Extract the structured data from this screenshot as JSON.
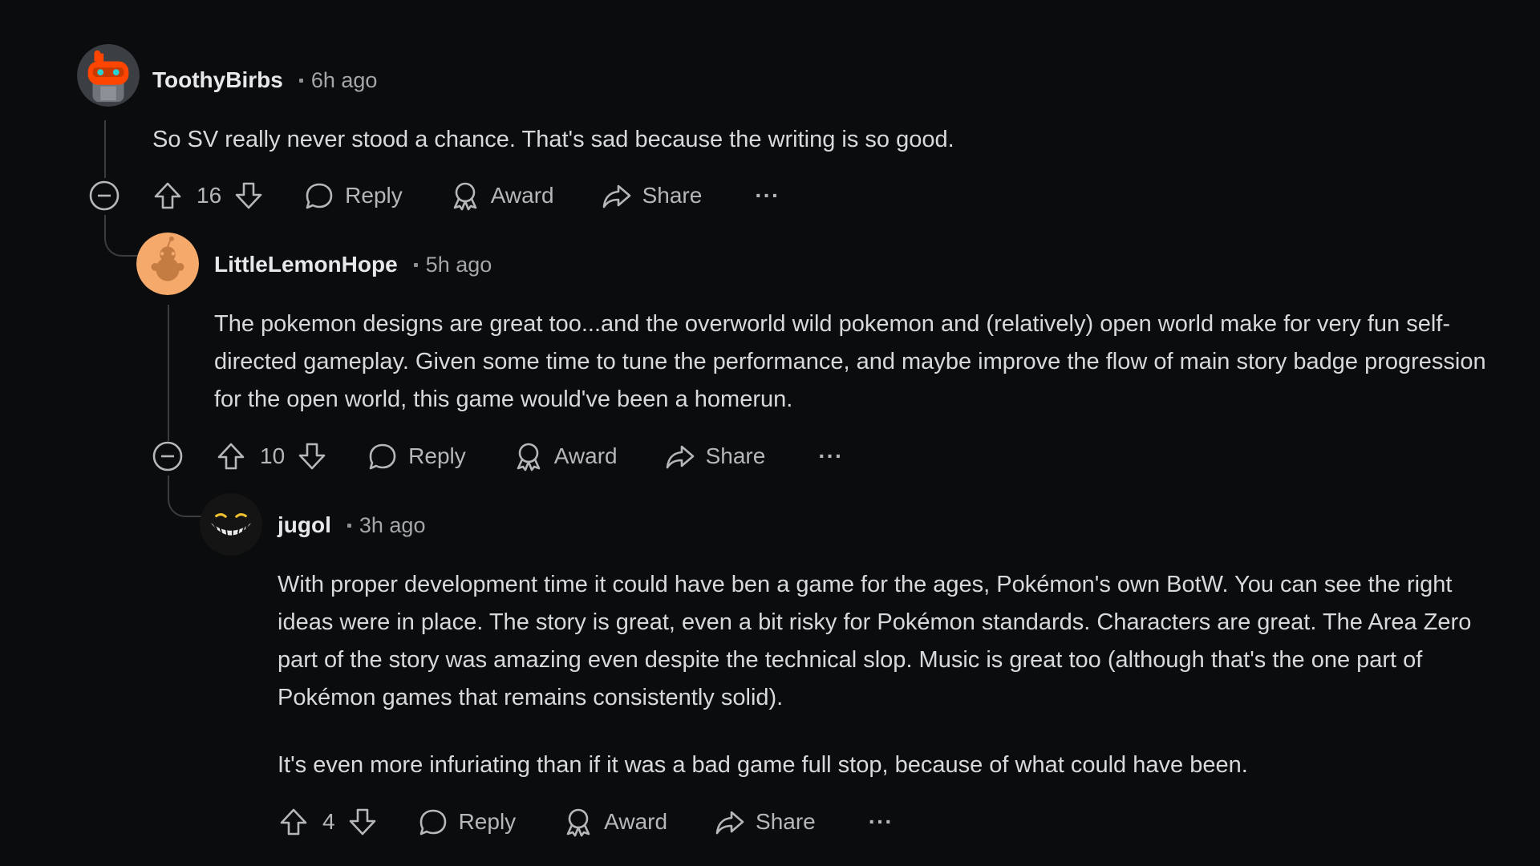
{
  "colors": {
    "background": "#0b0c0d",
    "text": "#d7dadc",
    "muted": "#a3a7aa",
    "thread_line": "#3a3c3e"
  },
  "comments": [
    {
      "username": "ToothyBirbs",
      "time": "6h ago",
      "avatar": "snoo-orange-robot-avatar",
      "paragraphs": [
        "So SV really never stood a chance. That's sad because the writing is so good."
      ],
      "votes": "16"
    },
    {
      "username": "LittleLemonHope",
      "time": "5h ago",
      "avatar": "snoo-peach-default-avatar",
      "paragraphs": [
        "The pokemon designs are great too...and the overworld wild pokemon and (relatively) open world make for very fun self-directed gameplay. Given some time to tune the performance, and maybe improve the flow of main story badge progression for the open world, this game would've been a homerun."
      ],
      "votes": "10"
    },
    {
      "username": "jugol",
      "time": "3h ago",
      "avatar": "grinning-face-avatar",
      "paragraphs": [
        "With proper development time it could have ben a game for the ages, Pokémon's own BotW. You can see the right ideas were in place. The story is great, even a bit risky for Pokémon standards. Characters are great. The Area Zero part of the story was amazing even despite the technical slop. Music is great too (although that's the one part of Pokémon games that remains consistently solid).",
        "It's even more infuriating than if it was a bad game full stop, because of what could have been."
      ],
      "votes": "4"
    }
  ],
  "actions": {
    "reply": "Reply",
    "award": "Award",
    "share": "Share",
    "more": "···"
  },
  "icons": {
    "upvote": "upvote-arrow-icon",
    "downvote": "downvote-arrow-icon",
    "reply": "speech-bubble-icon",
    "award": "award-ribbon-icon",
    "share": "share-arrow-icon",
    "collapse": "collapse-minus-circle-icon"
  }
}
